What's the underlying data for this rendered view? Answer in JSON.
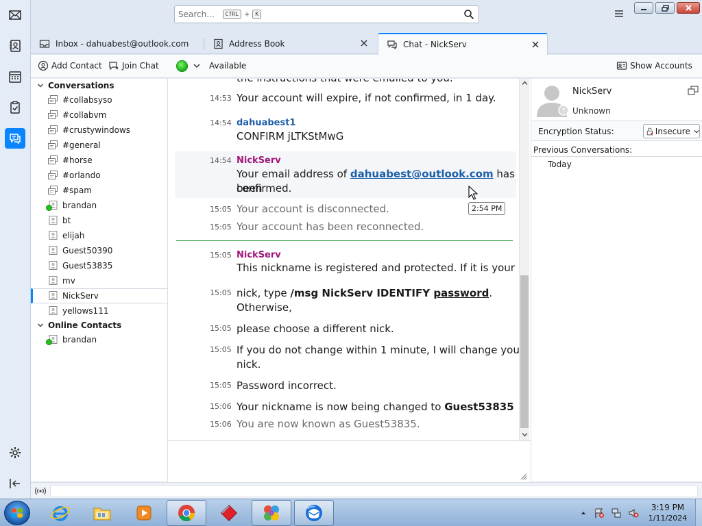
{
  "search": {
    "placeholder": "Search...",
    "key1": "CTRL",
    "plus": "+",
    "key2": "K"
  },
  "tabs": [
    {
      "label": "Inbox - dahuabest@outlook.com",
      "icon": "inbox-icon"
    },
    {
      "label": "Address Book",
      "icon": "address-book-icon"
    },
    {
      "label": "Chat - NickServ",
      "icon": "chat-icon",
      "active": true
    }
  ],
  "toolbar": {
    "add_contact": "Add Contact",
    "join_chat": "Join Chat",
    "status": "Available",
    "show_accounts": "Show Accounts"
  },
  "contacts": {
    "conversations_header": "Conversations",
    "conversations": [
      {
        "name": "#collabsyso",
        "type": "channel"
      },
      {
        "name": "#collabvm",
        "type": "channel"
      },
      {
        "name": "#crustywindows",
        "type": "channel"
      },
      {
        "name": "#general",
        "type": "channel"
      },
      {
        "name": "#horse",
        "type": "channel"
      },
      {
        "name": "#orlando",
        "type": "channel"
      },
      {
        "name": "#spam",
        "type": "channel"
      },
      {
        "name": "brandan",
        "type": "person-online"
      },
      {
        "name": "bt",
        "type": "person"
      },
      {
        "name": "elijah",
        "type": "person"
      },
      {
        "name": "Guest50390",
        "type": "person"
      },
      {
        "name": "Guest53835",
        "type": "person"
      },
      {
        "name": "mv",
        "type": "person"
      },
      {
        "name": "NickServ",
        "type": "person",
        "selected": true
      },
      {
        "name": "yellows111",
        "type": "person"
      }
    ],
    "online_header": "Online Contacts",
    "online": [
      {
        "name": "brandan",
        "type": "person-online"
      }
    ]
  },
  "conversation": {
    "partial_top": "the instructions that were emailed to you.",
    "m1": {
      "time": "14:53",
      "text": "Your account will expire, if not confirmed, in 1 day."
    },
    "m2": {
      "time": "14:54",
      "nick": "dahuabest1",
      "text": "CONFIRM jLTKStMwG"
    },
    "m3": {
      "time": "14:54",
      "nick": "NickServ",
      "pre": "Your email address of ",
      "link": "dahuabest@outlook.com",
      "post": " has been",
      "line2": "confirmed."
    },
    "tooltip": "2:54 PM",
    "s1": {
      "time": "15:05",
      "text": "Your account is disconnected."
    },
    "s2": {
      "time": "15:05",
      "text": "Your account has been reconnected."
    },
    "m4": {
      "time": "15:05",
      "nick": "NickServ",
      "text": "This nickname is registered and protected.  If it is your"
    },
    "m5": {
      "time": "15:05",
      "pre": "nick, type ",
      "cmd": "/msg NickServ IDENTIFY ",
      "arg": "password",
      "post": ".",
      "line2": "Otherwise,"
    },
    "m6": {
      "time": "15:05",
      "text": "please choose a different nick."
    },
    "m7": {
      "time": "15:05",
      "text": "If you do not change within 1 minute, I will change your",
      "line2": "nick."
    },
    "m8": {
      "time": "15:05",
      "text": "Password incorrect."
    },
    "m9": {
      "time": "15:06",
      "pre": "Your nickname is now being changed to ",
      "bold": "Guest53835"
    },
    "s3": {
      "time": "15:06",
      "text": "You are now known as Guest53835."
    }
  },
  "info": {
    "name": "NickServ",
    "status": "Unknown",
    "encryption_label": "Encryption Status:",
    "encryption_value": "Insecure",
    "previous_header": "Previous Conversations:",
    "previous": [
      "Today"
    ]
  },
  "taskbar": {
    "apps": [
      "internet-explorer",
      "windows-explorer",
      "media-player",
      "chrome",
      "red-diamond-app",
      "colorful-app",
      "thunderbird"
    ],
    "time": "3:19 PM",
    "date": "1/11/2024"
  }
}
